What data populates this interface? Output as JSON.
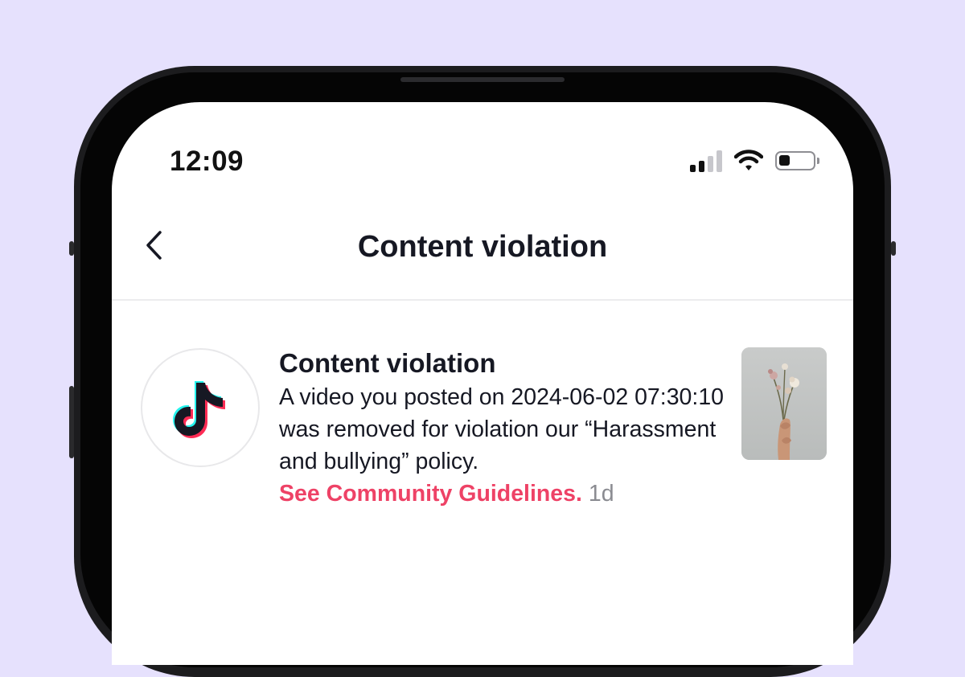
{
  "status_bar": {
    "time": "12:09",
    "icons": [
      "cellular-signal-icon",
      "wifi-icon",
      "battery-icon"
    ]
  },
  "header": {
    "title": "Content violation",
    "back_icon": "chevron-left-icon"
  },
  "notification": {
    "title": "Content violation",
    "body": "A video you posted on 2024-06-02 07:30:10 was removed for violation our “Harassment and bullying” policy.",
    "link_text": "See Community Guidelines.",
    "age": "1d",
    "avatar_icon": "tiktok-logo-icon",
    "thumbnail_icon": "flower-in-hand-thumbnail"
  },
  "colors": {
    "page_background": "#e6e1fd",
    "link": "#ee4266",
    "text": "#161823",
    "muted": "#8a8b91"
  }
}
